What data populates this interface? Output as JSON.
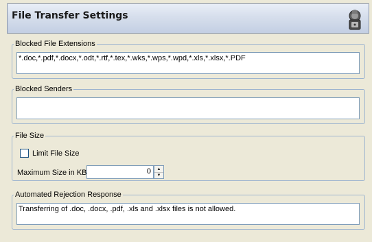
{
  "header": {
    "title": "File Transfer Settings",
    "icon": "lock-user-icon"
  },
  "blocked_extensions": {
    "legend": "Blocked File Extensions",
    "value": "*.doc,*.pdf,*.docx,*.odt,*.rtf,*.tex,*.wks,*.wps,*.wpd,*.xls,*.xlsx,*.PDF"
  },
  "blocked_senders": {
    "legend": "Blocked Senders",
    "value": ""
  },
  "file_size": {
    "legend": "File Size",
    "limit_label": "Limit File Size",
    "limit_checked": false,
    "max_size_label": "Maximum Size in KB:",
    "max_size_value": "0"
  },
  "rejection": {
    "legend": "Automated Rejection Response",
    "value": "Transferring of .doc, .docx, .pdf, .xls and .xlsx files is not allowed."
  },
  "colors": {
    "background": "#ece9d8",
    "group_border": "#9db4cf",
    "input_border": "#7f9db9",
    "checkbox_border": "#1c5180"
  }
}
